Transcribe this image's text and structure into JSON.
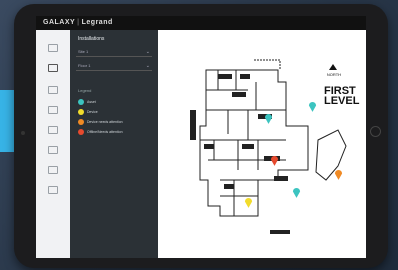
{
  "app": {
    "brand": "GALAXY",
    "brand_partner": "Legrand"
  },
  "panel": {
    "title": "Installations",
    "selects": [
      {
        "value": "Site 1"
      },
      {
        "value": "Floor 1"
      }
    ],
    "legend_title": "Legend",
    "legend": [
      {
        "label": "Asset",
        "color": "#3cc4c0"
      },
      {
        "label": "Device",
        "color": "#f2dc2c"
      },
      {
        "label": "Device needs attention",
        "color": "#f08a24"
      },
      {
        "label": "Offline/Needs attention",
        "color": "#e64a2e"
      }
    ]
  },
  "map": {
    "level_title": "FIRST LEVEL",
    "north_label": "NORTH"
  },
  "colors": {
    "accent": "#37b3e6",
    "sidebar": "#2b3136",
    "topbar": "#111111"
  }
}
